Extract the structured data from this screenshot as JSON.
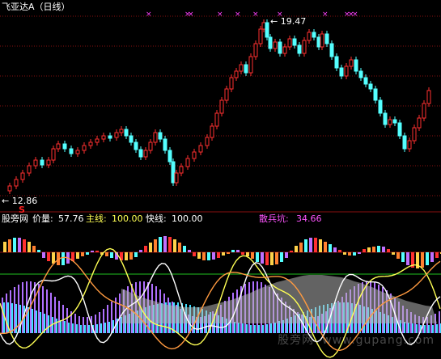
{
  "app": {
    "stock_title": "飞亚达A（日线）",
    "accent_color": "#ff3030",
    "bear_color": "#54ffff",
    "bull_color": "#ff3030",
    "background": "#000000"
  },
  "price_chart": {
    "high_label": "19.47",
    "low_label": "12.86",
    "buy_signal_label": "S",
    "high_marker": "← 19.47",
    "low_marker": "← 12.86"
  },
  "indicator_panel": {
    "source_label": "股旁网",
    "price_qty_label": "价量:",
    "price_qty_value": "57.76",
    "main_line_label": "主线:",
    "main_line_value": "100.00",
    "fast_line_label": "快线:",
    "fast_line_value": "100.00",
    "retail_pit_label": "散兵坑:",
    "retail_pit_value": "34.66"
  },
  "watermark": {
    "cn": "股旁网",
    "url": "www.gupang.com"
  },
  "chart_data": {
    "type": "candlestick",
    "title": "飞亚达A（日线）",
    "price_high": 19.47,
    "price_low": 12.86,
    "indicator_values": {
      "价量": 57.76,
      "主线": 100.0,
      "快线": 100.0,
      "散兵坑": 34.66
    }
  }
}
